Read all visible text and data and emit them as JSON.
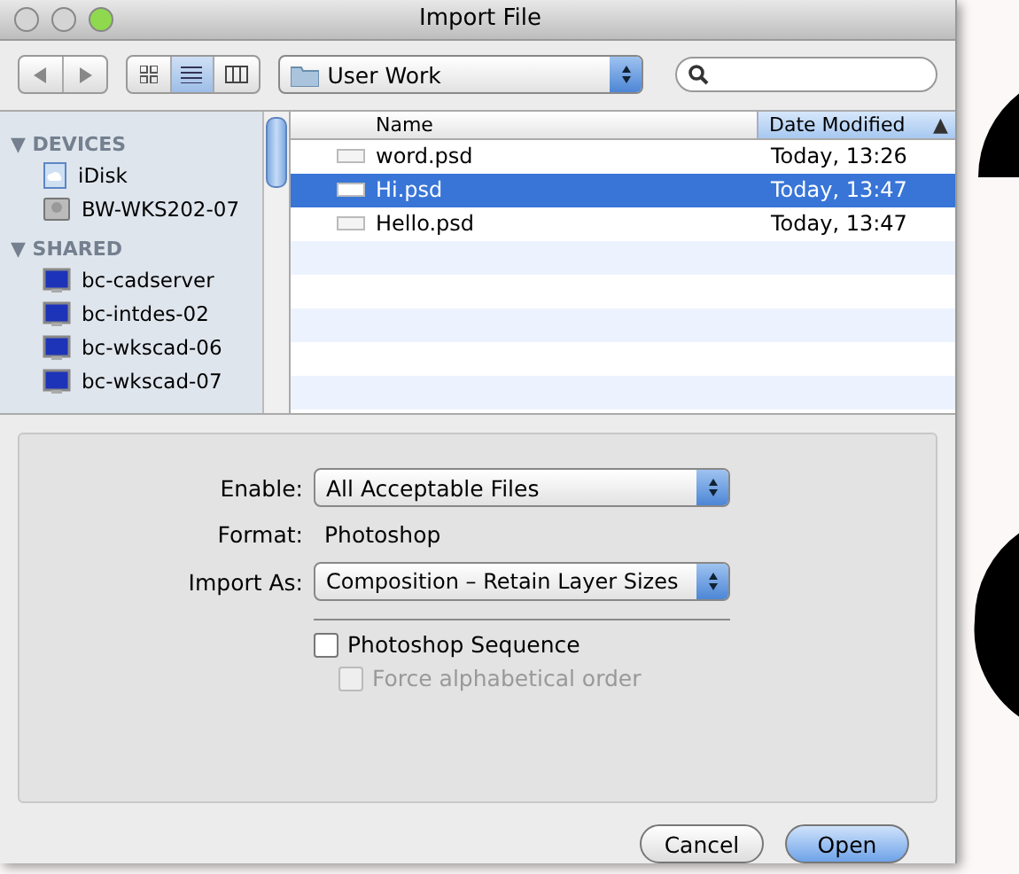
{
  "window": {
    "title": "Import File"
  },
  "views": [
    {
      "kind": "icons",
      "selected": false
    },
    {
      "kind": "list",
      "selected": true
    },
    {
      "kind": "columns",
      "selected": false
    }
  ],
  "location": {
    "value": "User Work"
  },
  "sidebar": {
    "sections": [
      {
        "label": "▼ DEVICES",
        "items": [
          {
            "kind": "disk",
            "label": "iDisk"
          },
          {
            "kind": "drive",
            "label": "BW-WKS202-07"
          }
        ]
      },
      {
        "label": "▼ SHARED",
        "items": [
          {
            "kind": "computer",
            "label": "bc-cadserver"
          },
          {
            "kind": "computer",
            "label": "bc-intdes-02"
          },
          {
            "kind": "computer",
            "label": "bc-wkscad-06"
          },
          {
            "kind": "computer",
            "label": "bc-wkscad-07"
          }
        ]
      }
    ]
  },
  "table": {
    "columns": [
      {
        "label": "Name",
        "sorted": false
      },
      {
        "label": "Date Modified",
        "sorted": true,
        "arrow": "▲"
      }
    ],
    "rows": [
      {
        "name": "word.psd",
        "date": "Today, 13:26",
        "selected": false
      },
      {
        "name": "Hi.psd",
        "date": "Today, 13:47",
        "selected": true
      },
      {
        "name": "Hello.psd",
        "date": "Today, 13:47",
        "selected": false
      }
    ]
  },
  "options": {
    "enable": {
      "label": "Enable:",
      "value": "All Acceptable Files"
    },
    "format": {
      "label": "Format:",
      "value": "Photoshop"
    },
    "import_as": {
      "label": "Import As:",
      "value": "Composition – Retain Layer Sizes"
    },
    "checkboxes": [
      {
        "label": "Photoshop Sequence",
        "checked": false,
        "disabled": false
      },
      {
        "label": "Force alphabetical order",
        "checked": false,
        "disabled": true
      }
    ]
  },
  "buttons": [
    {
      "label": "Cancel",
      "default": false
    },
    {
      "label": "Open",
      "default": true
    }
  ]
}
